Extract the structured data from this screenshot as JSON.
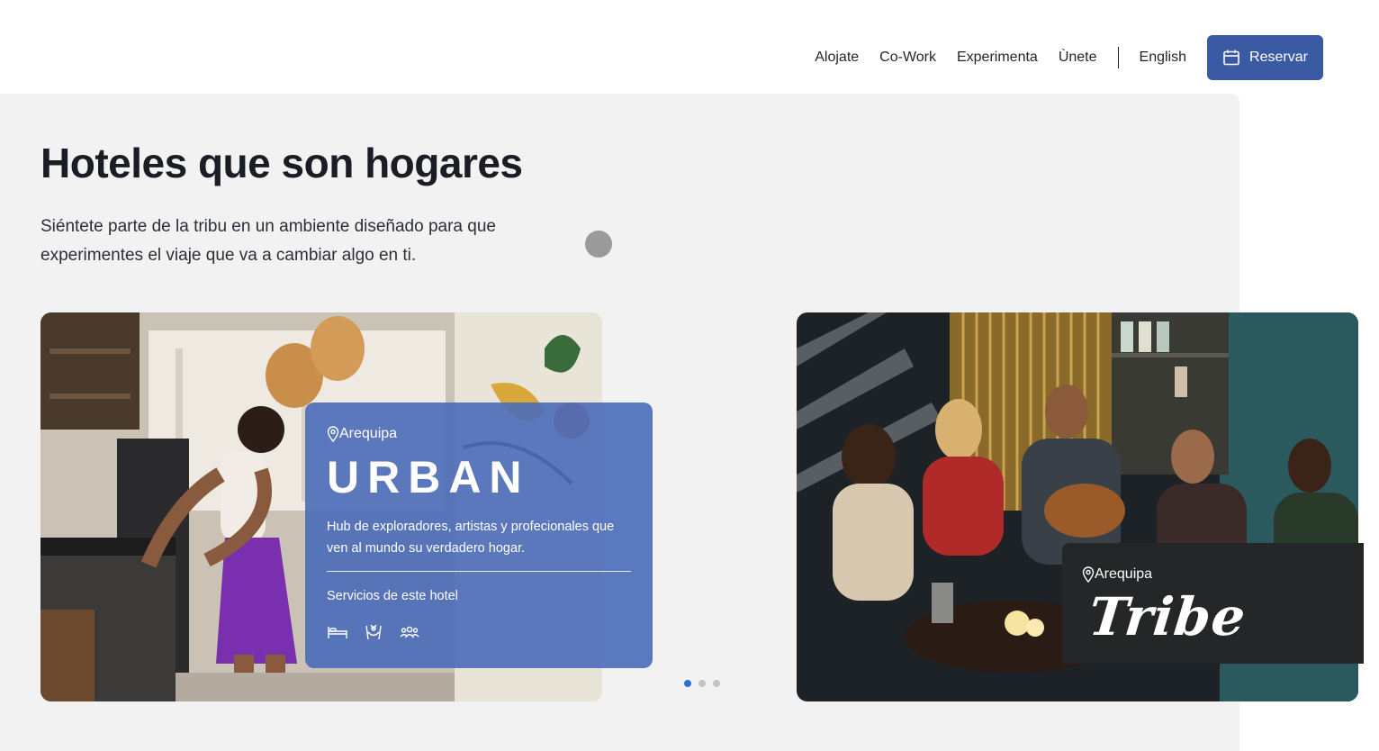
{
  "nav": {
    "links": [
      "Alojate",
      "Co-Work",
      "Experimenta",
      "Ùnete"
    ],
    "language": "English",
    "reserve_label": "Reservar",
    "reserve_icon": "calendar-icon",
    "accent_color": "#3a5ba4"
  },
  "hero": {
    "title": "Hoteles que son hogares",
    "subtitle": "Siéntete parte de la tribu en un ambiente diseñado para que experimentes el viaje que va a cambiar algo en ti."
  },
  "carousel": {
    "active_index": 0,
    "slide_count": 3,
    "cards": [
      {
        "location": "Arequipa",
        "name": "URBAN",
        "description": "Hub de exploradores, artistas y profecionales que ven al mundo su verdadero hogar.",
        "services_label": "Servicios de este hotel",
        "services": [
          "bed-icon",
          "hammock-icon",
          "community-icon"
        ],
        "overlay_color": "#4a6cb8"
      },
      {
        "location": "Arequipa",
        "name": "Tribe",
        "overlay_color": "#252628"
      }
    ]
  }
}
